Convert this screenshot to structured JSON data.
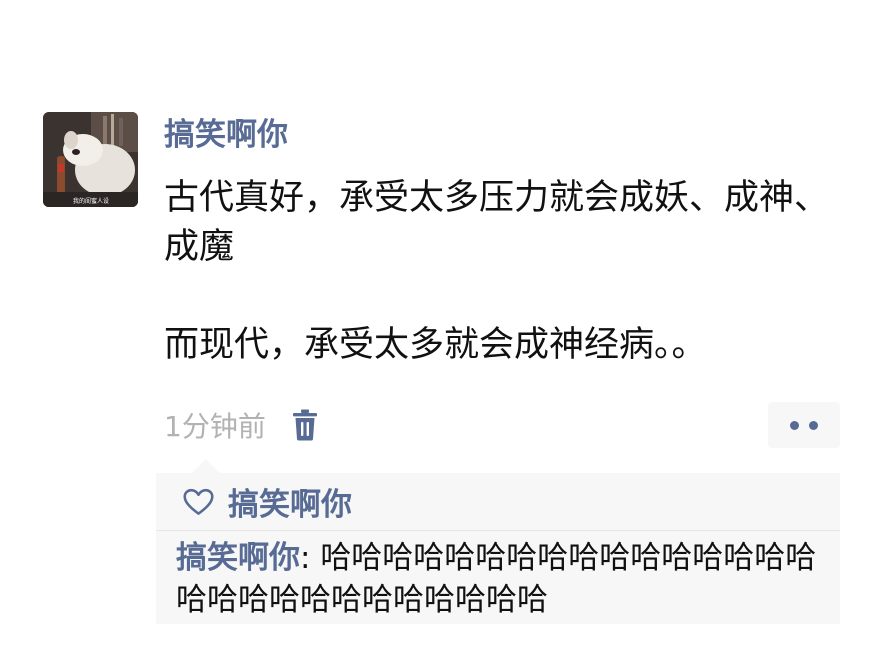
{
  "post": {
    "username": "搞笑啊你",
    "content_line1": "古代真好，承受太多压力就会成妖、成神、成魔",
    "content_line2": "而现代，承受太多就会成神经病。。",
    "time": "1分钟前",
    "avatar_caption": "我的闺蜜人设"
  },
  "likes": {
    "names": "搞笑啊你"
  },
  "comments": [
    {
      "author": "搞笑啊你",
      "separator": ": ",
      "text": "哈哈哈哈哈哈哈哈哈哈哈哈哈哈哈哈哈哈哈哈哈哈哈哈哈哈哈哈"
    }
  ],
  "colors": {
    "name": "#576b95",
    "text": "#111111",
    "muted": "#b2b2b2",
    "panel": "#f7f7f7"
  },
  "icons": {
    "delete": "trash-icon",
    "more": "more-dots-icon",
    "like": "heart-outline-icon"
  }
}
